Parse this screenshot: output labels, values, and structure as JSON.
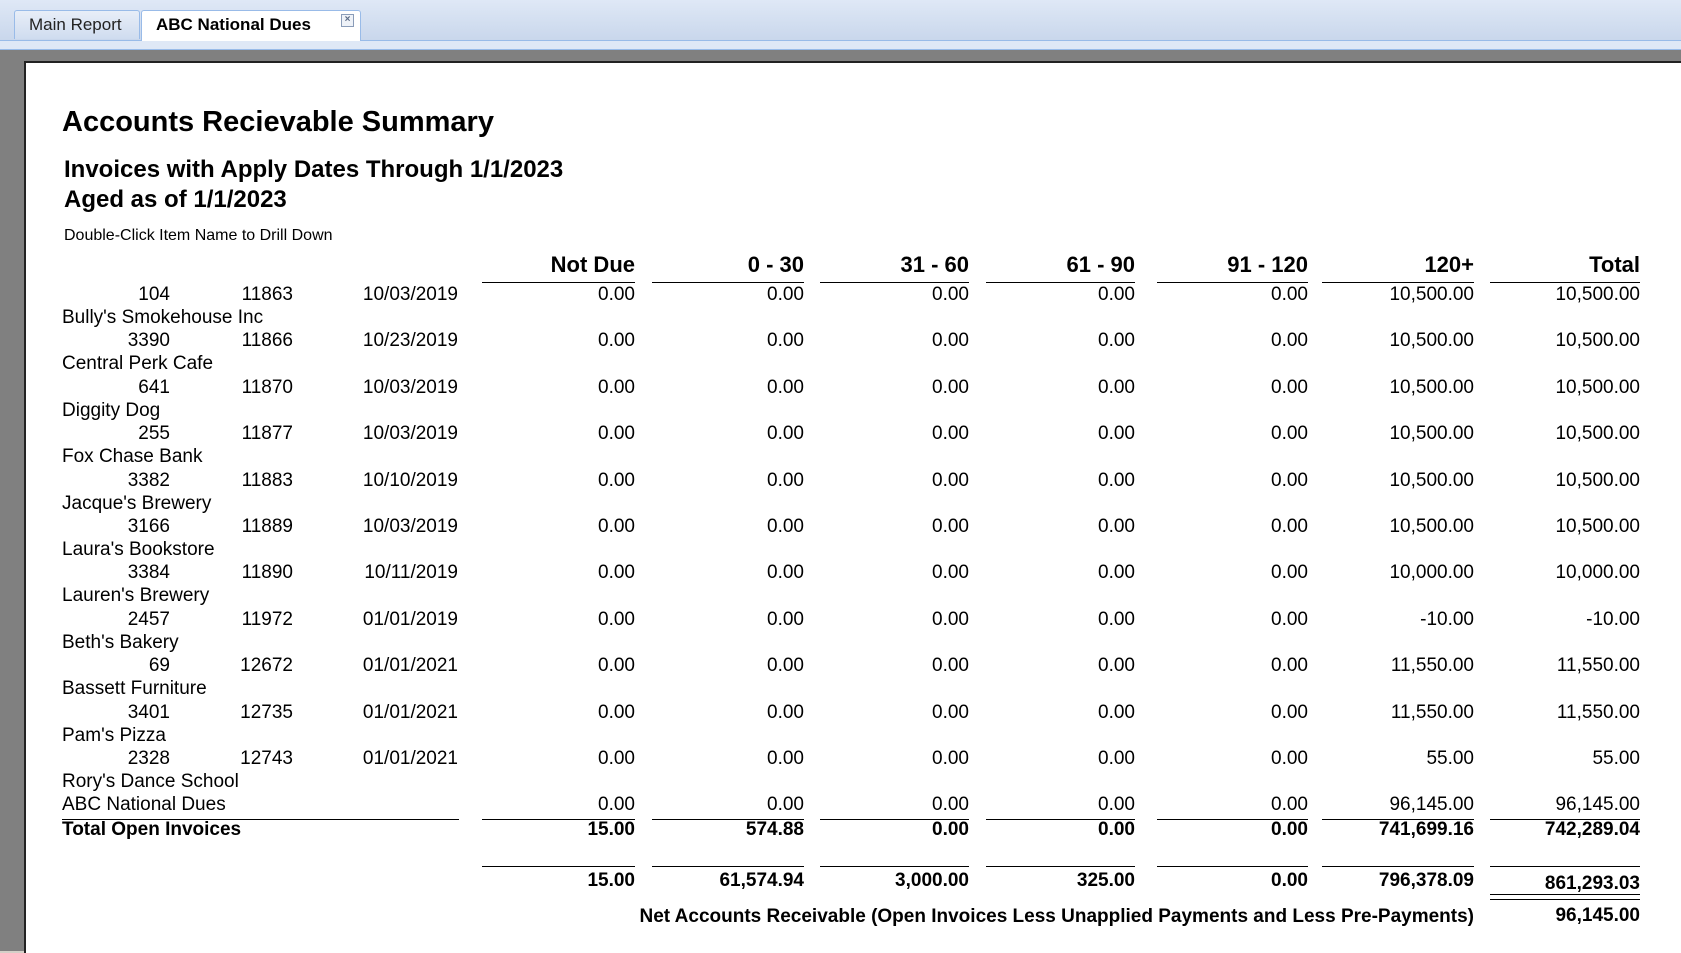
{
  "tabs": [
    {
      "label": "Main Report",
      "active": false
    },
    {
      "label": "ABC National Dues",
      "active": true
    }
  ],
  "report": {
    "title": "Accounts Recievable Summary",
    "subtitle_line1": "Invoices with Apply Dates Through 1/1/2023",
    "subtitle_line2": "Aged as of 1/1/2023",
    "hint": "Double-Click Item Name to Drill Down"
  },
  "columns": [
    "Not Due",
    "0 - 30",
    "31 - 60",
    "61 - 90",
    "91 - 120",
    "120+",
    "Total"
  ],
  "rows": [
    {
      "id": "104",
      "invoice": "11863",
      "date": "10/03/2019",
      "values": [
        "0.00",
        "0.00",
        "0.00",
        "0.00",
        "0.00",
        "10,500.00",
        "10,500.00"
      ],
      "name": "Bully's Smokehouse Inc"
    },
    {
      "id": "3390",
      "invoice": "11866",
      "date": "10/23/2019",
      "values": [
        "0.00",
        "0.00",
        "0.00",
        "0.00",
        "0.00",
        "10,500.00",
        "10,500.00"
      ],
      "name": "Central Perk Cafe"
    },
    {
      "id": "641",
      "invoice": "11870",
      "date": "10/03/2019",
      "values": [
        "0.00",
        "0.00",
        "0.00",
        "0.00",
        "0.00",
        "10,500.00",
        "10,500.00"
      ],
      "name": "Diggity Dog"
    },
    {
      "id": "255",
      "invoice": "11877",
      "date": "10/03/2019",
      "values": [
        "0.00",
        "0.00",
        "0.00",
        "0.00",
        "0.00",
        "10,500.00",
        "10,500.00"
      ],
      "name": "Fox Chase Bank"
    },
    {
      "id": "3382",
      "invoice": "11883",
      "date": "10/10/2019",
      "values": [
        "0.00",
        "0.00",
        "0.00",
        "0.00",
        "0.00",
        "10,500.00",
        "10,500.00"
      ],
      "name": "Jacque's Brewery"
    },
    {
      "id": "3166",
      "invoice": "11889",
      "date": "10/03/2019",
      "values": [
        "0.00",
        "0.00",
        "0.00",
        "0.00",
        "0.00",
        "10,500.00",
        "10,500.00"
      ],
      "name": "Laura's Bookstore"
    },
    {
      "id": "3384",
      "invoice": "11890",
      "date": "10/11/2019",
      "values": [
        "0.00",
        "0.00",
        "0.00",
        "0.00",
        "0.00",
        "10,000.00",
        "10,000.00"
      ],
      "name": "Lauren's Brewery"
    },
    {
      "id": "2457",
      "invoice": "11972",
      "date": "01/01/2019",
      "values": [
        "0.00",
        "0.00",
        "0.00",
        "0.00",
        "0.00",
        "-10.00",
        "-10.00"
      ],
      "name": "Beth's Bakery"
    },
    {
      "id": "69",
      "invoice": "12672",
      "date": "01/01/2021",
      "values": [
        "0.00",
        "0.00",
        "0.00",
        "0.00",
        "0.00",
        "11,550.00",
        "11,550.00"
      ],
      "name": "Bassett Furniture"
    },
    {
      "id": "3401",
      "invoice": "12735",
      "date": "01/01/2021",
      "values": [
        "0.00",
        "0.00",
        "0.00",
        "0.00",
        "0.00",
        "11,550.00",
        "11,550.00"
      ],
      "name": "Pam's Pizza"
    },
    {
      "id": "2328",
      "invoice": "12743",
      "date": "01/01/2021",
      "values": [
        "0.00",
        "0.00",
        "0.00",
        "0.00",
        "0.00",
        "55.00",
        "55.00"
      ],
      "name": "Rory's Dance School"
    }
  ],
  "group_total": {
    "label": "ABC National Dues",
    "values": [
      "0.00",
      "0.00",
      "0.00",
      "0.00",
      "0.00",
      "96,145.00",
      "96,145.00"
    ]
  },
  "total_open": {
    "label": "Total Open Invoices",
    "values": [
      "15.00",
      "574.88",
      "0.00",
      "0.00",
      "0.00",
      "741,699.16",
      "742,289.04"
    ]
  },
  "grand": {
    "values": [
      "15.00",
      "61,574.94",
      "3,000.00",
      "325.00",
      "0.00",
      "796,378.09",
      "861,293.03"
    ]
  },
  "net": {
    "label": "Net Accounts Receivable (Open Invoices Less Unapplied Payments and Less Pre-Payments)",
    "value": "96,145.00"
  }
}
